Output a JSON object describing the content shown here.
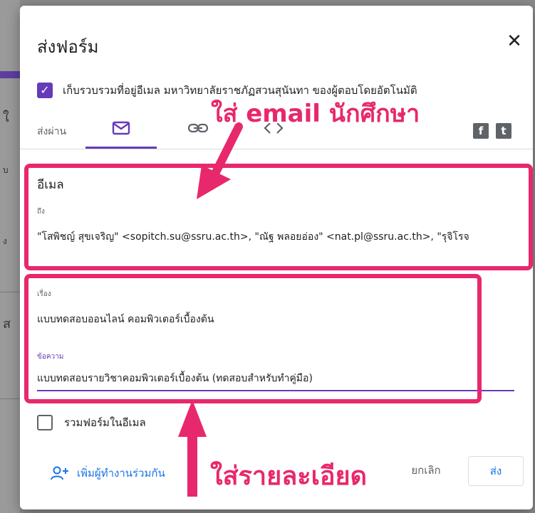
{
  "dialog": {
    "title": "ส่งฟอร์ม",
    "close_glyph": "✕",
    "collect_email_label": "เก็บรวบรวมที่อยู่อีเมล มหาวิทยาลัยราชภัฏสวนสุนันทา ของผู้ตอบโดยอัตโนมัติ",
    "collect_email_checked": true
  },
  "send_via": {
    "label": "ส่งผ่าน",
    "tabs": [
      {
        "icon": "mail-icon",
        "active": true
      },
      {
        "icon": "link-icon",
        "active": false
      },
      {
        "icon": "embed-icon",
        "active": false
      }
    ],
    "social": [
      {
        "icon": "facebook-icon",
        "glyph": "f"
      },
      {
        "icon": "twitter-icon",
        "glyph": "t"
      }
    ]
  },
  "email": {
    "section_title": "อีเมล",
    "to_label": "ถึง",
    "to_value": "\"โสพิชญ์ สุขเจริญ\" <sopitch.su@ssru.ac.th>, \"ณัฐ พลอยอ่อง\" <nat.pl@ssru.ac.th>, \"รุจิโรจ",
    "subject_label": "เรื่อง",
    "subject_value": "แบบทดสอบออนไลน์ คอมพิวเตอร์เบื้องต้น",
    "message_label": "ข้อความ",
    "message_value": "แบบทดสอบรายวิชาคอมพิวเตอร์เบื้องต้น (ทดสอบสำหรับทำคู่มือ)",
    "include_form_label": "รวมฟอร์มในอีเมล",
    "include_form_checked": false
  },
  "footer": {
    "add_collaborators": "เพิ่มผู้ทำงานร่วมกัน",
    "cancel": "ยกเลิก",
    "send": "ส่ง"
  },
  "annotations": {
    "email_hint": "ใส่ email นักศึกษา",
    "details_hint": "ใส่รายละเอียด",
    "color": "#e8286c"
  },
  "colors": {
    "accent": "#673ab7",
    "link": "#1a73e8"
  }
}
